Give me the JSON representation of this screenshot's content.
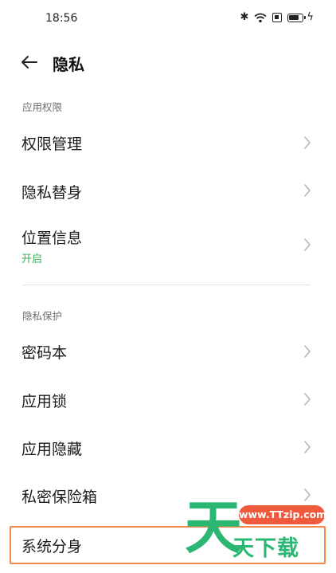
{
  "status": {
    "time": "18:56",
    "icons": [
      "bluetooth-icon",
      "wifi-icon",
      "sim-icon",
      "battery-icon",
      "charging-icon"
    ]
  },
  "header": {
    "title": "隐私"
  },
  "sections": [
    {
      "label": "应用权限",
      "items": [
        {
          "label": "权限管理"
        },
        {
          "label": "隐私替身"
        },
        {
          "label": "位置信息",
          "sub": "开启"
        }
      ]
    },
    {
      "label": "隐私保护",
      "items": [
        {
          "label": "密码本"
        },
        {
          "label": "应用锁"
        },
        {
          "label": "应用隐藏"
        },
        {
          "label": "私密保险箱"
        },
        {
          "label": "系统分身"
        }
      ]
    }
  ],
  "watermark": {
    "url": "www.TTzip.com",
    "big_char": "天",
    "text": "天下载"
  },
  "colors": {
    "accent_green": "#3fae5b",
    "highlight_orange": "#f08a4b",
    "watermark_green": "#2bb673",
    "watermark_red": "#ef5a3c"
  }
}
